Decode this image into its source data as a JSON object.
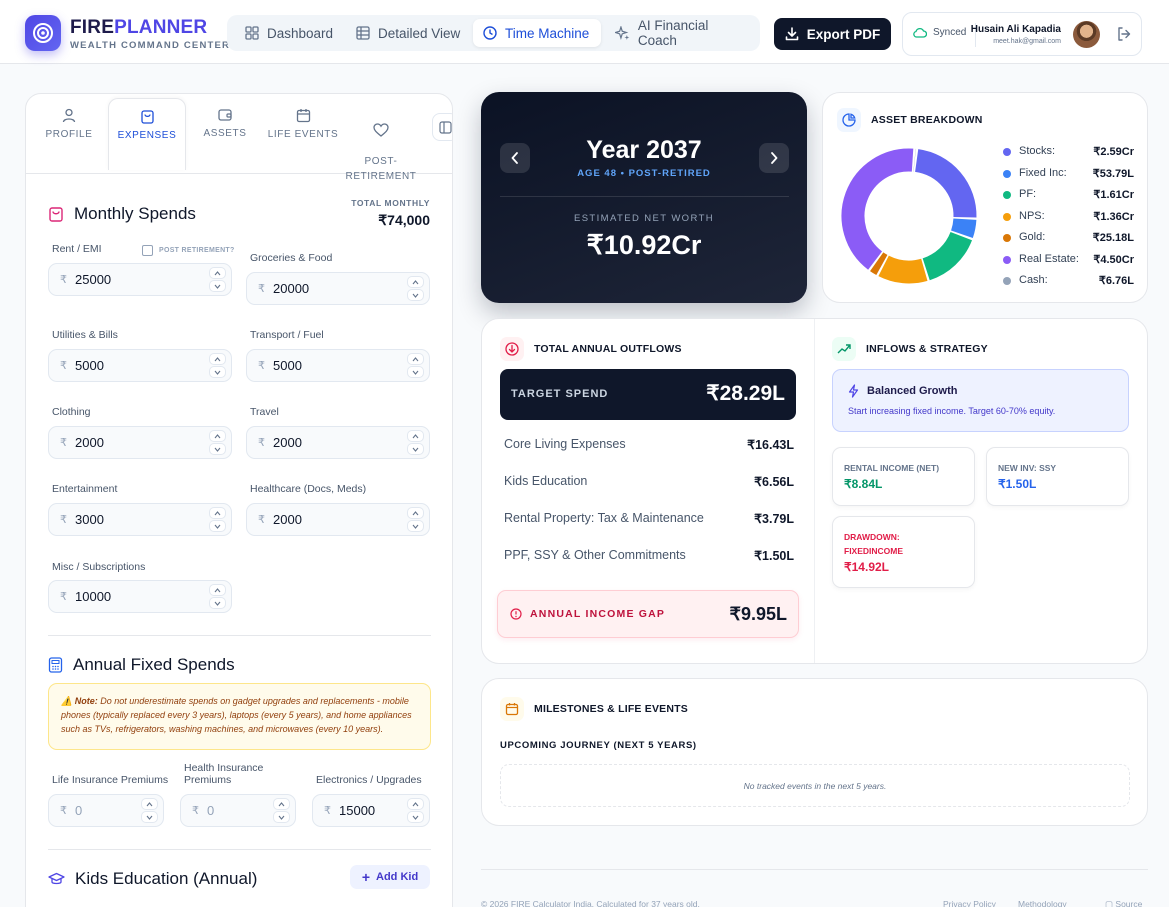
{
  "brand": {
    "title_a": "FIRE",
    "title_b": "PLANNER",
    "subtitle": "WEALTH COMMAND CENTER"
  },
  "nav": [
    {
      "label": "Dashboard",
      "icon": "grid-icon",
      "active": false
    },
    {
      "label": "Detailed View",
      "icon": "table-icon",
      "active": false
    },
    {
      "label": "Time Machine",
      "icon": "clock-icon",
      "active": true
    },
    {
      "label": "AI Financial Coach",
      "icon": "sparkles-icon",
      "active": false
    }
  ],
  "export_label": "Export PDF",
  "user": {
    "status": "Synced",
    "name": "Husain Ali Kapadia",
    "email": "meet.hak@gmail.com"
  },
  "tabs": [
    {
      "label": "PROFILE",
      "icon": "user-icon"
    },
    {
      "label": "EXPENSES",
      "icon": "shopping-bag-icon",
      "active": true
    },
    {
      "label": "ASSETS",
      "icon": "wallet-icon"
    },
    {
      "label": "LIFE EVENTS",
      "icon": "calendar-icon"
    },
    {
      "label": "POST-\nRETIREMENT",
      "icon": "heart-icon"
    }
  ],
  "monthly": {
    "title": "Monthly Spends",
    "total_label": "TOTAL MONTHLY",
    "total_value": "₹74,000",
    "post_retirement_label": "POST RETIREMENT?",
    "currency": "₹",
    "fields": [
      {
        "label": "Rent / EMI",
        "value": "25000"
      },
      {
        "label": "Groceries & Food",
        "value": "20000"
      },
      {
        "label": "Utilities & Bills",
        "value": "5000"
      },
      {
        "label": "Transport / Fuel",
        "value": "5000"
      },
      {
        "label": "Clothing",
        "value": "2000"
      },
      {
        "label": "Travel",
        "value": "2000"
      },
      {
        "label": "Entertainment",
        "value": "3000"
      },
      {
        "label": "Healthcare (Docs, Meds)",
        "value": "2000"
      },
      {
        "label": "Misc / Subscriptions",
        "value": "10000"
      }
    ]
  },
  "annual": {
    "title": "Annual Fixed Spends",
    "note_bold": "Note:",
    "note_text": " Do not underestimate spends on gadget upgrades and replacements - mobile phones (typically replaced every 3 years), laptops (every 5 years), and home appliances such as TVs, refrigerators, washing machines, and microwaves (every 10 years).",
    "fields": [
      {
        "label": "Life Insurance Premiums",
        "value": "0"
      },
      {
        "label": "Health Insurance Premiums",
        "value": "0"
      },
      {
        "label": "Electronics / Upgrades",
        "value": "15000"
      }
    ]
  },
  "kids": {
    "title": "Kids Education (Annual)",
    "add_label": "Add Kid"
  },
  "year_card": {
    "year": "Year 2037",
    "sub": "AGE 48 • POST-RETIRED",
    "nw_label": "ESTIMATED NET WORTH",
    "nw_value": "₹10.92Cr"
  },
  "asset_breakdown": {
    "title": "ASSET BREAKDOWN",
    "items": [
      {
        "name": "Stocks:",
        "value": "₹2.59Cr",
        "color": "#6366f1"
      },
      {
        "name": "Fixed Inc:",
        "value": "₹53.79L",
        "color": "#3b82f6"
      },
      {
        "name": "PF:",
        "value": "₹1.61Cr",
        "color": "#10b981"
      },
      {
        "name": "NPS:",
        "value": "₹1.36Cr",
        "color": "#f59e0b"
      },
      {
        "name": "Gold:",
        "value": "₹25.18L",
        "color": "#d97706"
      },
      {
        "name": "Real Estate:",
        "value": "₹4.50Cr",
        "color": "#8b5cf6"
      },
      {
        "name": "Cash:",
        "value": "₹6.76L",
        "color": "#94a3b8"
      }
    ]
  },
  "chart_data": {
    "type": "pie",
    "categories": [
      "Stocks",
      "Fixed Inc",
      "PF",
      "NPS",
      "Gold",
      "Real Estate",
      "Cash"
    ],
    "values": [
      259,
      53.79,
      161,
      136,
      25.18,
      450,
      6.76
    ],
    "title": "",
    "donut": true
  },
  "outflows": {
    "title": "TOTAL ANNUAL OUTFLOWS",
    "target_label": "TARGET SPEND",
    "target_value": "₹28.29L",
    "rows": [
      {
        "label": "Core Living Expenses",
        "value": "₹16.43L"
      },
      {
        "label": "Kids Education",
        "value": "₹6.56L"
      },
      {
        "label": "Rental Property: Tax & Maintenance",
        "value": "₹3.79L"
      },
      {
        "label": "PPF, SSY & Other Commitments",
        "value": "₹1.50L"
      }
    ],
    "gap_label": "ANNUAL INCOME GAP",
    "gap_value": "₹9.95L"
  },
  "inflows": {
    "title": "INFLOWS & STRATEGY",
    "strategy_title": "Balanced Growth",
    "strategy_desc": "Start increasing fixed income. Target 60-70% equity.",
    "cards": [
      {
        "label": "RENTAL INCOME (NET)",
        "value": "₹8.84L",
        "color": "#059669"
      },
      {
        "label": "NEW INV: SSY",
        "value": "₹1.50L",
        "color": "#2563eb"
      },
      {
        "label": "DRAWDOWN:\nFIXEDINCOME",
        "value": "₹14.92L",
        "color": "#e11d48"
      }
    ]
  },
  "milestones": {
    "title": "MILESTONES & LIFE EVENTS",
    "sub": "UPCOMING JOURNEY (NEXT 5 YEARS)",
    "empty": "No tracked events in the next 5 years."
  },
  "footer": {
    "copyright": "© 2026 FIRE Calculator India. Calculated for 37 years old.",
    "links": [
      "Privacy Policy",
      "Methodology",
      "Source"
    ]
  }
}
